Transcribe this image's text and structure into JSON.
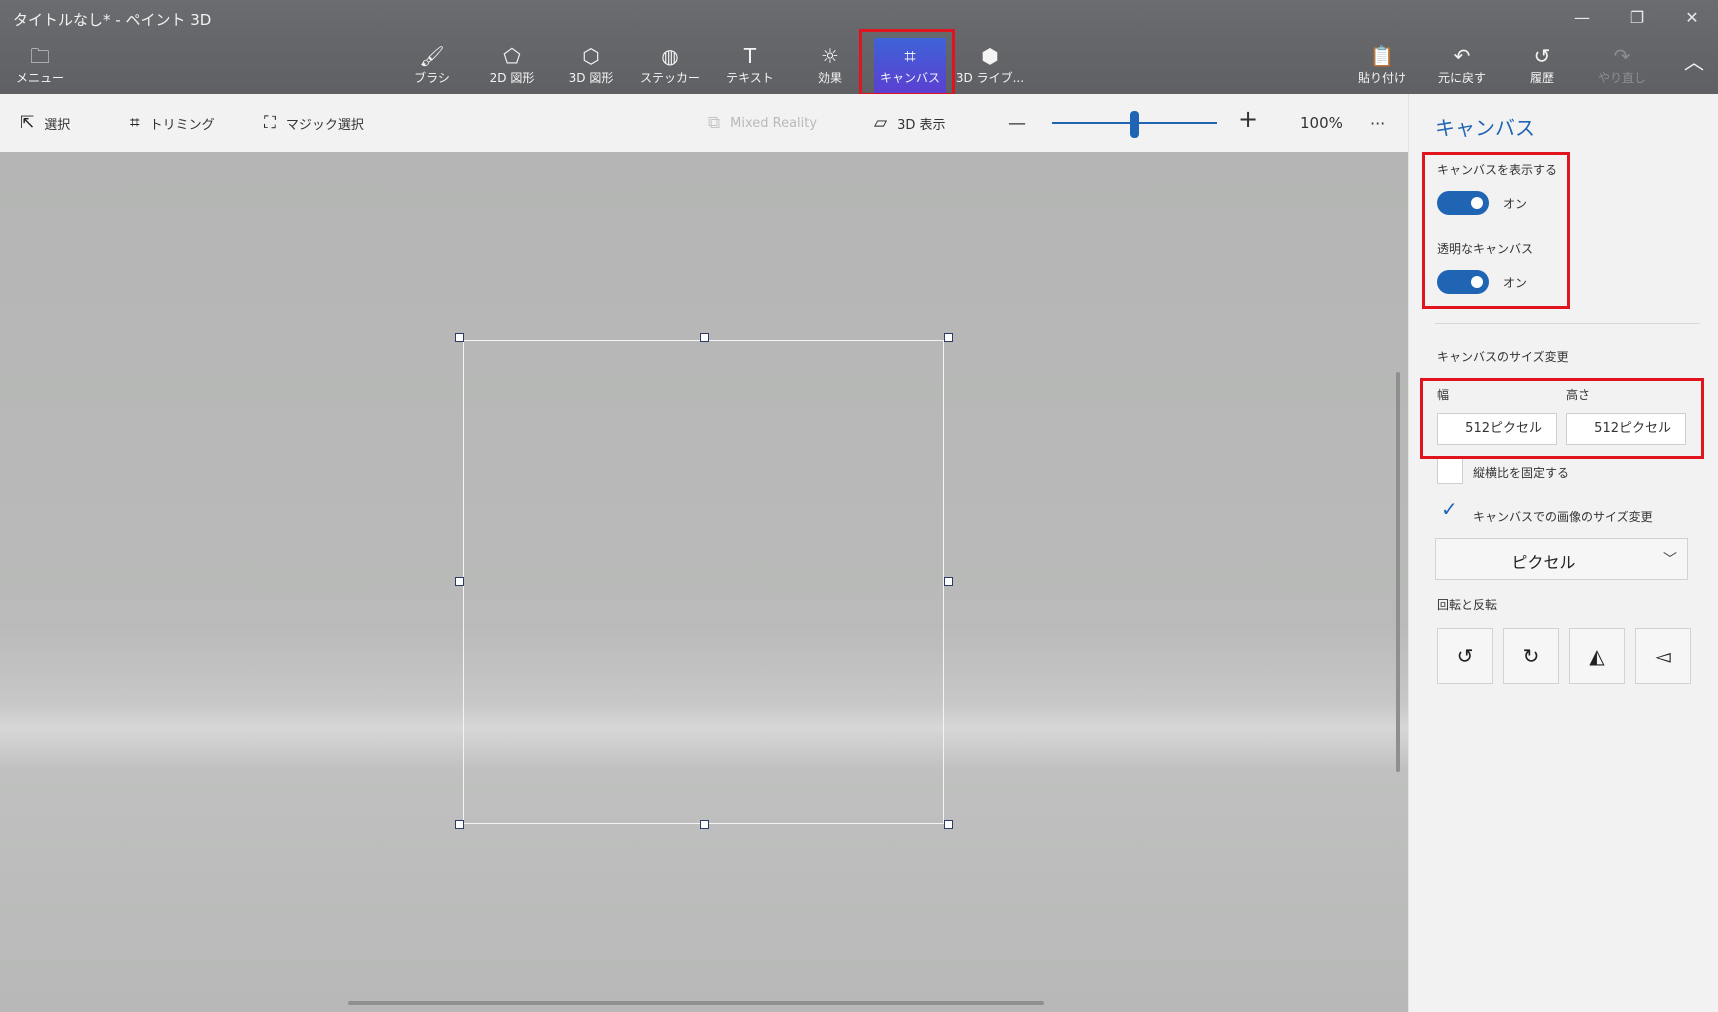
{
  "window": {
    "title": "タイトルなし* - ペイント 3D",
    "minimize": "—",
    "restore": "❐",
    "close": "✕"
  },
  "ribbon": {
    "menu": {
      "label": "メニュー",
      "icon": "folder-icon"
    },
    "tools": [
      {
        "label": "ブラシ",
        "icon": "brush-icon"
      },
      {
        "label": "2D 図形",
        "icon": "2d-shapes-icon"
      },
      {
        "label": "3D 図形",
        "icon": "3d-shapes-icon"
      },
      {
        "label": "ステッカー",
        "icon": "sticker-icon"
      },
      {
        "label": "テキスト",
        "icon": "text-icon"
      },
      {
        "label": "効果",
        "icon": "effects-icon"
      },
      {
        "label": "キャンバス",
        "icon": "canvas-icon",
        "active": true
      },
      {
        "label": "3D ライブ...",
        "icon": "3d-library-icon"
      }
    ],
    "right": [
      {
        "label": "貼り付け",
        "icon": "paste-icon"
      },
      {
        "label": "元に戻す",
        "icon": "undo-icon"
      },
      {
        "label": "履歴",
        "icon": "history-icon"
      },
      {
        "label": "やり直し",
        "icon": "redo-icon",
        "disabled": true
      }
    ],
    "collapse_icon": "chevron-up-icon"
  },
  "toolbar": {
    "select": "選択",
    "crop": "トリミング",
    "magic_select": "マジック選択",
    "mixed_reality": "Mixed Reality",
    "view_3d": "3D 表示",
    "zoom_minus": "—",
    "zoom_plus": "+",
    "zoom_level": "100%",
    "zoom_fraction": 0.55,
    "more": "···"
  },
  "panel": {
    "title": "キャンバス",
    "show_canvas": {
      "label": "キャンバスを表示する",
      "state": "オン",
      "on": true
    },
    "transparent_canvas": {
      "label": "透明なキャンバス",
      "state": "オン",
      "on": true
    },
    "resize_label": "キャンバスのサイズ変更",
    "width_label": "幅",
    "height_label": "高さ",
    "width_value": "512ピクセル",
    "height_value": "512ピクセル",
    "lock_aspect": {
      "label": "縦横比を固定する",
      "checked": false
    },
    "resize_image": {
      "label": "キャンバスでの画像のサイズ変更",
      "checked": true
    },
    "unit": "ピクセル",
    "rotate_label": "回転と反転",
    "rotate_buttons": [
      "rotate-left-icon",
      "rotate-right-icon",
      "flip-horizontal-icon",
      "flip-vertical-icon"
    ]
  },
  "colors": {
    "accent": "#1f65b4",
    "active_tab": "#4a52d6",
    "highlight": "#e0141e"
  }
}
